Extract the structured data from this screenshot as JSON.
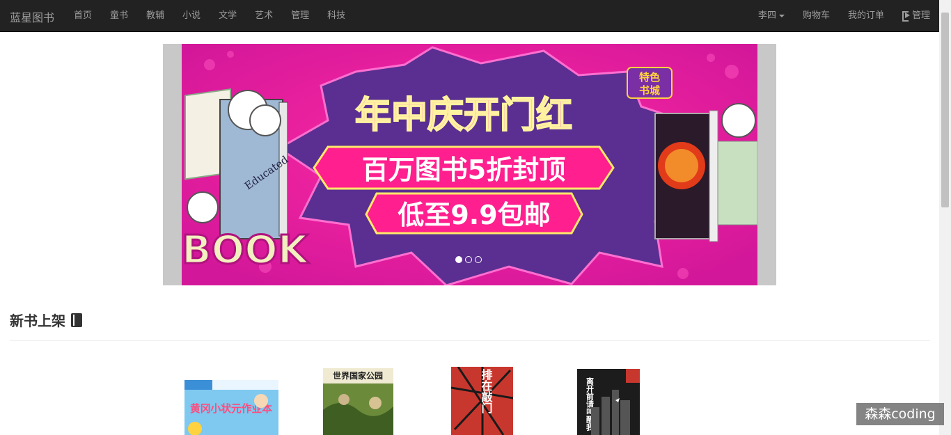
{
  "navbar": {
    "brand": "蓝星图书",
    "left_links": [
      "首页",
      "童书",
      "教辅",
      "小说",
      "文学",
      "艺术",
      "管理",
      "科技"
    ],
    "user": "李四",
    "cart": "购物车",
    "orders": "我的订单",
    "admin": "管理"
  },
  "carousel": {
    "banner": {
      "headline": "年中庆开门红",
      "line1": "百万图书5折封顶",
      "line2": "低至9.9包邮",
      "badge_top": "特色",
      "badge_bottom": "书城",
      "book_word": "BOOK",
      "educated": "Educated"
    },
    "slide_count": 3,
    "active_slide": 1
  },
  "new_books": {
    "title": "新书上架",
    "covers": [
      {
        "title": "黄冈小状元作业本"
      },
      {
        "title": "世界国家公园"
      },
      {
        "title": "排在敲门"
      },
      {
        "title": "离开前请叫醒我"
      }
    ]
  },
  "watermark": "森森coding"
}
